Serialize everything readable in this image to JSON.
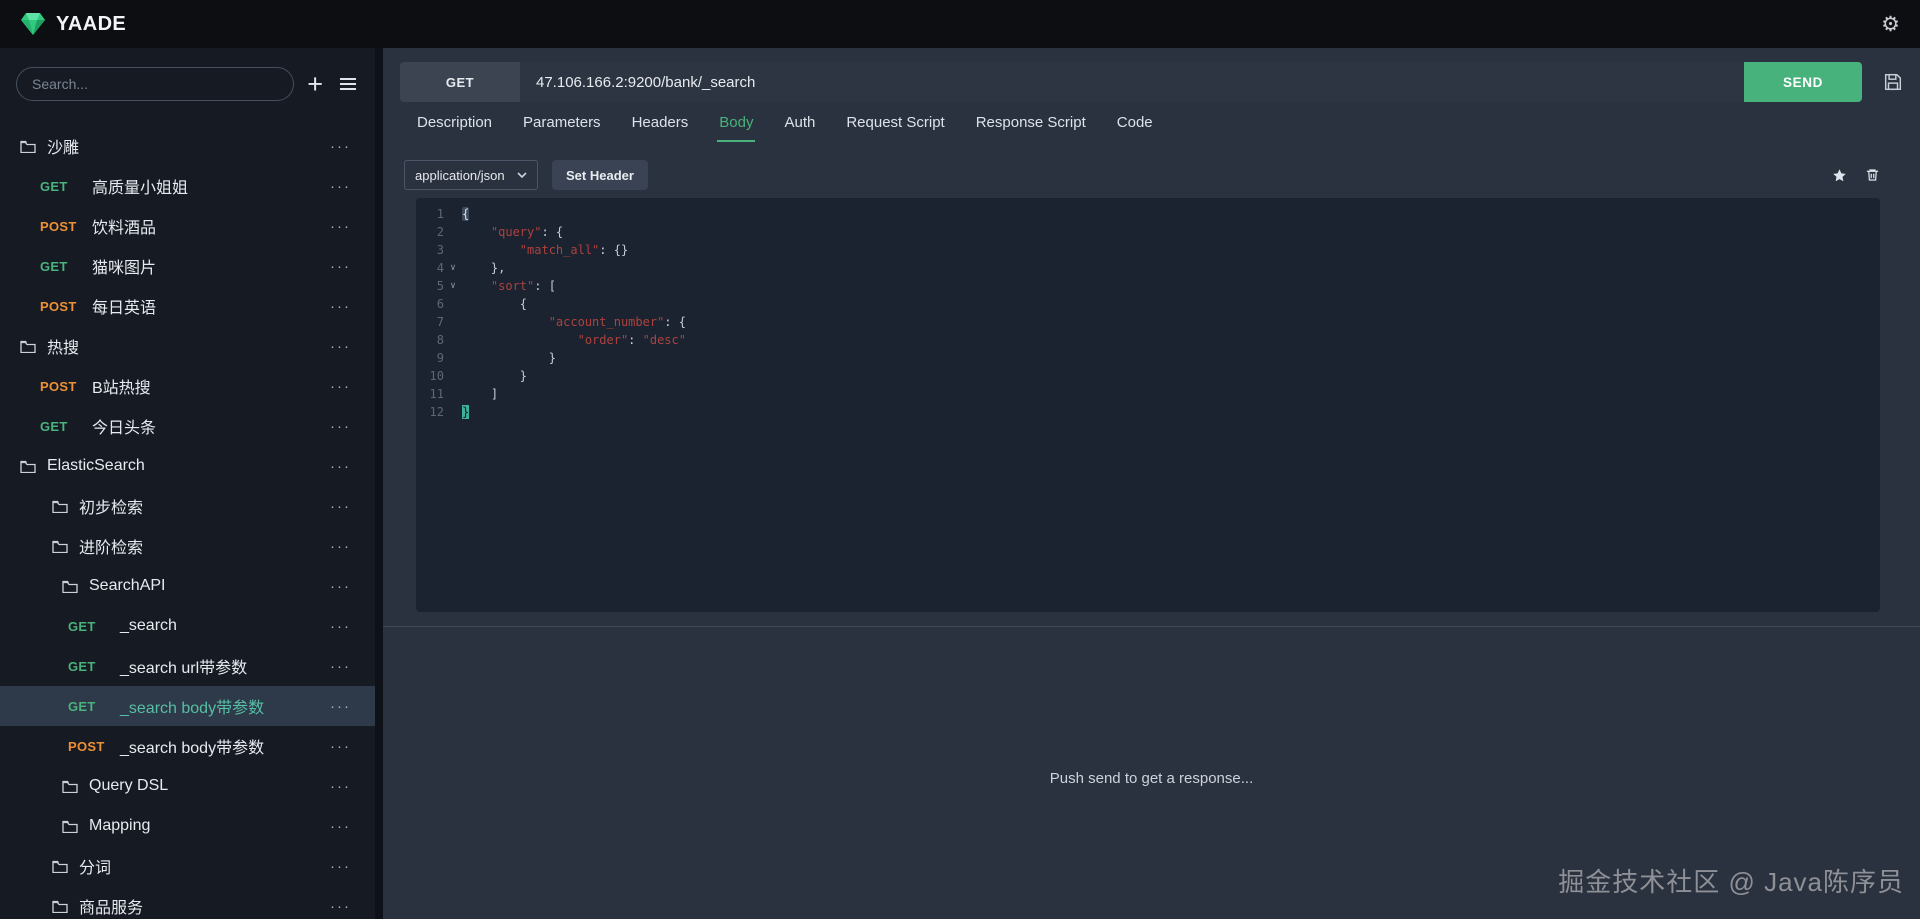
{
  "topbar": {
    "app_name": "YAADE"
  },
  "sidebar": {
    "search_placeholder": "Search...",
    "menu_icon": "···",
    "items": [
      {
        "type": "folder",
        "label": "沙雕",
        "indent": 20
      },
      {
        "type": "request",
        "method": "GET",
        "label": "高质量小姐姐",
        "indent": 40
      },
      {
        "type": "request",
        "method": "POST",
        "label": "饮料酒品",
        "indent": 40
      },
      {
        "type": "request",
        "method": "GET",
        "label": "猫咪图片",
        "indent": 40
      },
      {
        "type": "request",
        "method": "POST",
        "label": "每日英语",
        "indent": 40
      },
      {
        "type": "folder",
        "label": "热搜",
        "indent": 20
      },
      {
        "type": "request",
        "method": "POST",
        "label": "B站热搜",
        "indent": 40
      },
      {
        "type": "request",
        "method": "GET",
        "label": "今日头条",
        "indent": 40
      },
      {
        "type": "folder",
        "label": "ElasticSearch",
        "indent": 20
      },
      {
        "type": "folder",
        "label": "初步检索",
        "indent": 52
      },
      {
        "type": "folder",
        "label": "进阶检索",
        "indent": 52
      },
      {
        "type": "folder",
        "label": "SearchAPI",
        "indent": 62
      },
      {
        "type": "request",
        "method": "GET",
        "label": "_search",
        "indent": 68
      },
      {
        "type": "request",
        "method": "GET",
        "label": "_search url带参数",
        "indent": 68
      },
      {
        "type": "request",
        "method": "GET",
        "label": "_search body带参数",
        "indent": 68,
        "selected": true
      },
      {
        "type": "request",
        "method": "POST",
        "label": "_search body带参数",
        "indent": 68
      },
      {
        "type": "folder",
        "label": "Query DSL",
        "indent": 62
      },
      {
        "type": "folder",
        "label": "Mapping",
        "indent": 62
      },
      {
        "type": "folder",
        "label": "分词",
        "indent": 52
      },
      {
        "type": "folder",
        "label": "商品服务",
        "indent": 52
      }
    ]
  },
  "request": {
    "method": "GET",
    "url": "47.106.166.2:9200/bank/_search",
    "send_label": "SEND",
    "tabs": [
      "Description",
      "Parameters",
      "Headers",
      "Body",
      "Auth",
      "Request Script",
      "Response Script",
      "Code"
    ],
    "active_tab": "Body",
    "content_type": "application/json",
    "set_header_label": "Set Header"
  },
  "editor": {
    "lines": [
      {
        "n": "1",
        "fold": "",
        "tokens": [
          {
            "t": "{",
            "c": "match"
          }
        ]
      },
      {
        "n": "2",
        "fold": "",
        "tokens": [
          {
            "t": "    "
          },
          {
            "t": "\"query\"",
            "c": "str"
          },
          {
            "t": ": {"
          }
        ]
      },
      {
        "n": "3",
        "fold": "",
        "tokens": [
          {
            "t": "        "
          },
          {
            "t": "\"match_all\"",
            "c": "str"
          },
          {
            "t": ": {}"
          }
        ]
      },
      {
        "n": "4",
        "fold": "∨",
        "tokens": [
          {
            "t": "    },"
          }
        ]
      },
      {
        "n": "5",
        "fold": "∨",
        "tokens": [
          {
            "t": "    "
          },
          {
            "t": "\"sort\"",
            "c": "str"
          },
          {
            "t": ": ["
          }
        ]
      },
      {
        "n": "6",
        "fold": "",
        "tokens": [
          {
            "t": "        {"
          }
        ]
      },
      {
        "n": "7",
        "fold": "",
        "tokens": [
          {
            "t": "            "
          },
          {
            "t": "\"account_number\"",
            "c": "str"
          },
          {
            "t": ": {"
          }
        ]
      },
      {
        "n": "8",
        "fold": "",
        "tokens": [
          {
            "t": "                "
          },
          {
            "t": "\"order\"",
            "c": "str"
          },
          {
            "t": ": "
          },
          {
            "t": "\"desc\"",
            "c": "str"
          }
        ]
      },
      {
        "n": "9",
        "fold": "",
        "tokens": [
          {
            "t": "            }"
          }
        ]
      },
      {
        "n": "10",
        "fold": "",
        "tokens": [
          {
            "t": "        }"
          }
        ]
      },
      {
        "n": "11",
        "fold": "",
        "tokens": [
          {
            "t": "    ]"
          }
        ]
      },
      {
        "n": "12",
        "fold": "",
        "tokens": [
          {
            "t": "}",
            "c": "cursor"
          }
        ]
      }
    ]
  },
  "response": {
    "placeholder": "Push send to get a response..."
  },
  "watermark": {
    "text": "掘金技术社区 @ Java陈序员"
  },
  "colors": {
    "get_method": "#4ab37b",
    "post_method": "#ee9035",
    "accent_green": "#47b27c",
    "string_token": "#ab423f"
  }
}
